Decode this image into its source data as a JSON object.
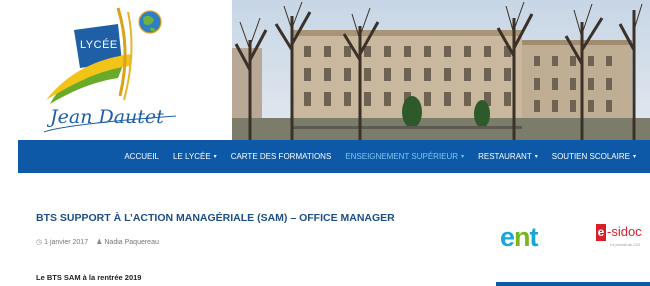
{
  "logo": {
    "school_type": "LYCÉE",
    "name": "Jean Dautet"
  },
  "nav": {
    "items": [
      {
        "label": "ACCUEIL",
        "has_menu": false,
        "active": false
      },
      {
        "label": "LE LYCÉE",
        "has_menu": true,
        "active": false
      },
      {
        "label": "CARTE DES FORMATIONS",
        "has_menu": false,
        "active": false
      },
      {
        "label": "ENSEIGNEMENT SUPÉRIEUR",
        "has_menu": true,
        "active": true
      },
      {
        "label": "RESTAURANT",
        "has_menu": true,
        "active": false
      },
      {
        "label": "SOUTIEN SCOLAIRE",
        "has_menu": true,
        "active": false
      }
    ],
    "caret": "▾"
  },
  "article": {
    "title": "BTS SUPPORT À L’ACTION MANAGÉRIALE (SAM) – OFFICE MANAGER",
    "date": "1 janvier 2017",
    "author": "Nadia Paquereau",
    "subhead": "Le BTS SAM à la rentrée 2019"
  },
  "sidebar": {
    "ent_logo": {
      "e": "e",
      "n": "n",
      "t": "t"
    },
    "esidoc_logo": {
      "badge": "e",
      "word": "-sidoc",
      "tagline": "Le portail du CDI"
    }
  },
  "colors": {
    "nav_bg": "#0e58a8",
    "nav_active": "#7fc6f2",
    "title": "#1d4f86"
  }
}
